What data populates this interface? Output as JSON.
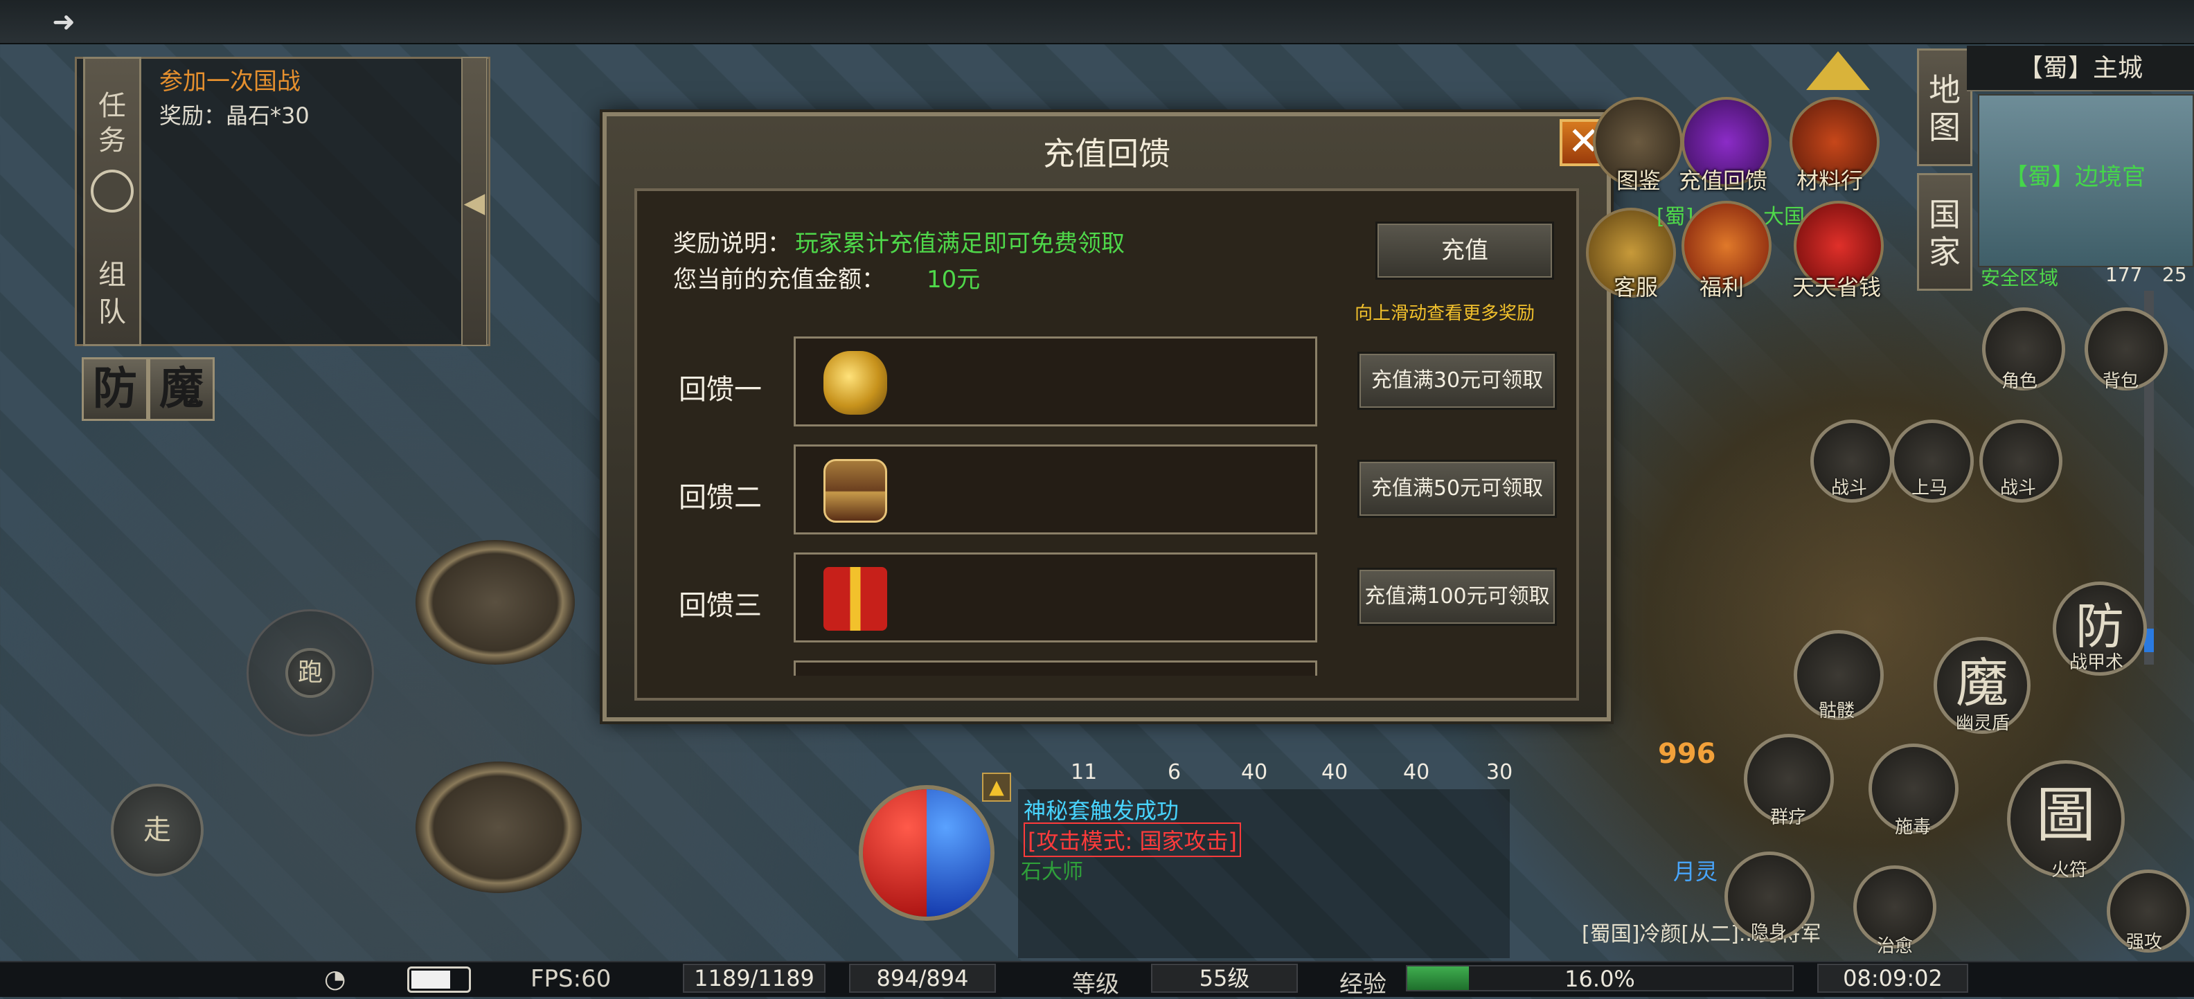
{
  "top_bar": {
    "exit_icon": "arrow-right-icon"
  },
  "quest": {
    "tabs": [
      "任",
      "务",
      "组",
      "队"
    ],
    "title": "参加一次国战",
    "reward": "奖励：晶石*30"
  },
  "mode_buttons": [
    "防",
    "魔"
  ],
  "joystick": {
    "run": "跑",
    "walk": "走"
  },
  "dialog": {
    "title": "充值回馈",
    "close_icon": "x",
    "description_label": "奖励说明：",
    "description_value": "玩家累计充值满足即可免费领取",
    "amount_label": "您当前的充值金额：",
    "amount_value": "10元",
    "recharge_button": "充值",
    "scroll_hint": "向上滑动查看更多奖励",
    "rewards": [
      {
        "label": "回馈一",
        "icon": "gold-ore-icon",
        "button": "充值满30元可领取"
      },
      {
        "label": "回馈二",
        "icon": "treasure-chest-icon",
        "button": "充值满50元可领取"
      },
      {
        "label": "回馈三",
        "icon": "gift-box-icon",
        "button": "充值满100元可领取"
      }
    ]
  },
  "top_menu": [
    {
      "label": "图鉴",
      "icon": "codex-icon"
    },
    {
      "label": "充值回馈",
      "icon": "gift-icon"
    },
    {
      "label": "材料行",
      "icon": "pagoda-icon"
    },
    {
      "label": "客服",
      "icon": "service-icon"
    },
    {
      "label": "福利",
      "icon": "bag-icon"
    },
    {
      "label": "天天省钱",
      "icon": "gift-red-icon"
    }
  ],
  "top_menu_extra": "[蜀]",
  "top_menu_extra2": "大国",
  "minimap": {
    "title": "【蜀】主城",
    "npc": "【蜀】边境官",
    "zone": "安全区域",
    "x": "177",
    "y": "25"
  },
  "side_tabs": [
    {
      "label": "地图"
    },
    {
      "label": "国家"
    }
  ],
  "skills": [
    {
      "label": "角色"
    },
    {
      "label": "背包"
    },
    {
      "label": "战斗"
    },
    {
      "label": "上马"
    },
    {
      "label": "战斗"
    },
    {
      "label": "战甲术",
      "glyph": "防"
    },
    {
      "label": "骷髅"
    },
    {
      "label": "幽灵盾",
      "glyph": "魔"
    },
    {
      "label": "群疗"
    },
    {
      "label": "施毒"
    },
    {
      "label": "火符",
      "glyph": "圖"
    },
    {
      "label": "隐身"
    },
    {
      "label": "治愈"
    },
    {
      "label": "强攻"
    }
  ],
  "hud": {
    "damage": "996",
    "quickbar_counts": [
      "11",
      "6",
      "40",
      "40",
      "40",
      "30"
    ],
    "player_name": "月灵",
    "monster_name": "石大师",
    "chat": [
      {
        "text": "神秘套触发成功",
        "color": "#48d4ff"
      },
      {
        "text": "[攻击模式: 国家攻击]",
        "color": "#ff3b3b"
      },
      {
        "text": "[蜀国]冷颜[从二]...男将军",
        "color": "#e6e0cc"
      }
    ]
  },
  "status_bar": {
    "fps": "FPS:60",
    "hp": "1189/1189",
    "mp": "894/894",
    "level_label": "等级",
    "level": "55级",
    "exp_label": "经验",
    "exp_percent": 16.0,
    "exp_text": "16.0%",
    "time": "08:09:02"
  },
  "colors": {
    "accent_green": "#4fd84a",
    "accent_gold": "#f2c12c",
    "close_orange": "#d77a1f"
  }
}
